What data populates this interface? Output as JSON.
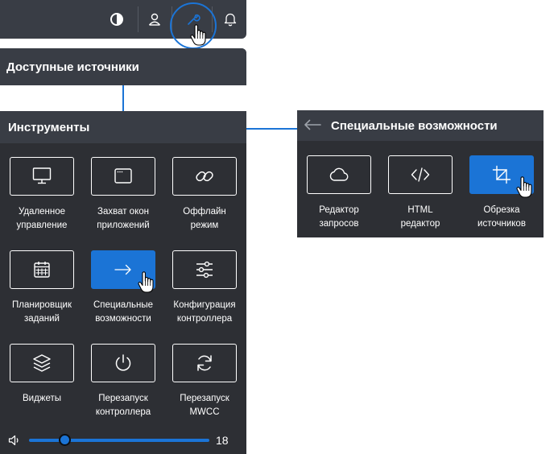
{
  "topbar": {
    "icons": [
      "contrast-icon",
      "user-icon",
      "wrench-icon",
      "bell-icon"
    ]
  },
  "sources": {
    "title": "Доступные источники"
  },
  "tools": {
    "title": "Инструменты",
    "tiles": [
      {
        "line1": "Удаленное",
        "line2": "управление",
        "icon": "monitor-icon"
      },
      {
        "line1": "Захват окон",
        "line2": "приложений",
        "icon": "app-window-icon"
      },
      {
        "line1": "Оффлайн",
        "line2": "режим",
        "icon": "link-icon"
      },
      {
        "line1": "Планировщик",
        "line2": "заданий",
        "icon": "calendar-icon"
      },
      {
        "line1": "Специальные",
        "line2": "возможности",
        "icon": "arrow-right-icon",
        "active": true
      },
      {
        "line1": "Конфигурация",
        "line2": "контроллера",
        "icon": "sliders-icon"
      },
      {
        "line1": "Виджеты",
        "line2": "",
        "icon": "layers-icon"
      },
      {
        "line1": "Перезапуск",
        "line2": "контроллера",
        "icon": "power-icon"
      },
      {
        "line1": "Перезапуск",
        "line2": "MWCC",
        "icon": "refresh-icon"
      }
    ],
    "volume": {
      "value": "18",
      "level": 0.2
    }
  },
  "special": {
    "title": "Специальные возможности",
    "tiles": [
      {
        "line1": "Редактор",
        "line2": "запросов",
        "icon": "cloud-icon"
      },
      {
        "line1": "HTML",
        "line2": "редактор",
        "icon": "code-icon"
      },
      {
        "line1": "Обрезка",
        "line2": "источников",
        "icon": "crop-icon",
        "active": true
      }
    ]
  },
  "colors": {
    "accent": "#1b74d6",
    "panel": "#2d2f34",
    "header": "#393d45"
  }
}
